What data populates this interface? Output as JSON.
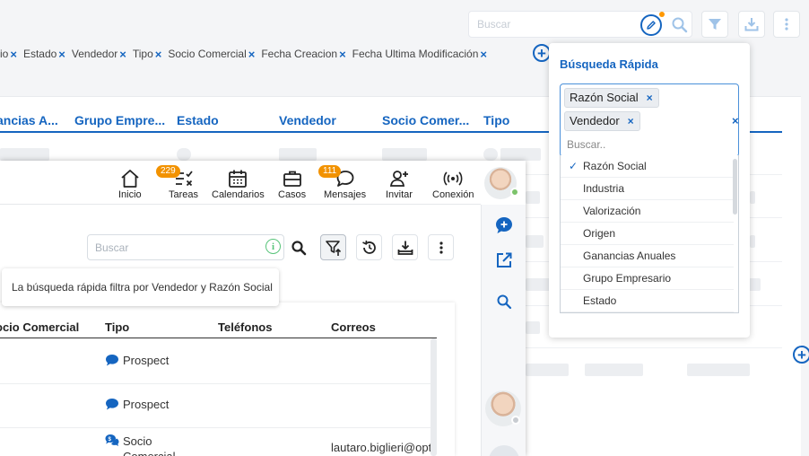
{
  "top_search": {
    "placeholder": "Buscar"
  },
  "filter_chips": [
    {
      "label": "rio"
    },
    {
      "label": "Estado"
    },
    {
      "label": "Vendedor"
    },
    {
      "label": "Tipo"
    },
    {
      "label": "Socio Comercial"
    },
    {
      "label": "Fecha Creacion"
    },
    {
      "label": "Fecha Ultima Modificación"
    }
  ],
  "chip_remove_symbol": "×",
  "add_symbol": "+",
  "background_table": {
    "columns": [
      "ancias A...",
      "Grupo Empre...",
      "Estado",
      "Vendedor",
      "Socio Comer...",
      "Tipo"
    ]
  },
  "inner_window": {
    "nav": [
      {
        "label": "Inicio",
        "icon": "home-icon"
      },
      {
        "label": "Tareas",
        "icon": "tasks-icon",
        "badge": "229"
      },
      {
        "label": "Calendarios",
        "icon": "calendar-icon"
      },
      {
        "label": "Casos",
        "icon": "briefcase-icon"
      },
      {
        "label": "Mensajes",
        "icon": "chat-icon",
        "badge": "111"
      },
      {
        "label": "Invitar",
        "icon": "invite-user-icon"
      },
      {
        "label": "Conexión",
        "icon": "connection-icon"
      }
    ],
    "search": {
      "placeholder": "Buscar"
    },
    "info_symbol": "i",
    "tooltip": "La búsqueda rápida filtra por Vendedor y Razón Social",
    "table": {
      "columns": [
        "ocio Comercial",
        "Tipo",
        "Teléfonos",
        "Correos"
      ],
      "rows": [
        {
          "tipo": "Prospect",
          "correo": ""
        },
        {
          "tipo": "Prospect",
          "correo": ""
        },
        {
          "tipo": "Socio\nComercial",
          "correo": "lautaro.biglieri@opt"
        }
      ]
    }
  },
  "quick_search": {
    "title": "Búsqueda Rápida",
    "selected": [
      "Razón Social",
      "Vendedor"
    ],
    "clear_symbol": "×",
    "input_placeholder": "Buscar..",
    "check_symbol": "✓",
    "options": [
      {
        "label": "Razón Social",
        "checked": true
      },
      {
        "label": "Industria",
        "checked": false
      },
      {
        "label": "Valorización",
        "checked": false
      },
      {
        "label": "Origen",
        "checked": false
      },
      {
        "label": "Ganancias Anuales",
        "checked": false
      },
      {
        "label": "Grupo Empresario",
        "checked": false
      },
      {
        "label": "Estado",
        "checked": false
      }
    ]
  },
  "colors": {
    "accent": "#1565c0",
    "badge": "#f29200",
    "online": "#7cc36b",
    "info": "#58c47a"
  }
}
